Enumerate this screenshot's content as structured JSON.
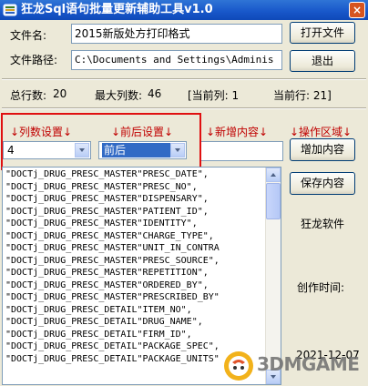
{
  "window": {
    "title": "狂龙Sql语句批量更新辅助工具v1.0",
    "close_glyph": "×"
  },
  "file_name": {
    "label": "文件名:",
    "value": "2015新版处方打印格式"
  },
  "file_path": {
    "label": "文件路径:",
    "value": "C:\\Documents and Settings\\Adminis"
  },
  "buttons": {
    "open_file": "打开文件",
    "exit": "退出",
    "add_content": "增加内容",
    "save_content": "保存内容"
  },
  "stats": {
    "total_label": "总行数:",
    "total_value": "20",
    "max_cols_label": "最大列数:",
    "max_cols_value": "46",
    "current_col": "[当前列: 1",
    "current_row": "当前行: 21]"
  },
  "section_headers": {
    "col_settings": "↓列数设置↓",
    "prefix_suffix": "↓前后设置↓",
    "new_content": "↓新增内容↓",
    "action_area": "↓操作区域↓"
  },
  "col_settings_combo": {
    "value": "4"
  },
  "prefix_suffix_combo": {
    "value": "前后"
  },
  "list_rows": [
    "\"DOCTj_DRUG_PRESC_MASTER\"PRESC_DATE\",",
    "\"DOCTj_DRUG_PRESC_MASTER\"PRESC_NO\",",
    "\"DOCTj_DRUG_PRESC_MASTER\"DISPENSARY\",",
    "\"DOCTj_DRUG_PRESC_MASTER\"PATIENT_ID\",",
    "\"DOCTj_DRUG_PRESC_MASTER\"IDENTITY\",",
    "\"DOCTj_DRUG_PRESC_MASTER\"CHARGE_TYPE\",",
    "\"DOCTj_DRUG_PRESC_MASTER\"UNIT_IN_CONTRA",
    "\"DOCTj_DRUG_PRESC_MASTER\"PRESC_SOURCE\",",
    "\"DOCTj_DRUG_PRESC_MASTER\"REPETITION\",",
    "\"DOCTj_DRUG_PRESC_MASTER\"ORDERED_BY\",",
    "\"DOCTj_DRUG_PRESC_MASTER\"PRESCRIBED_BY\"",
    "\"DOCTj_DRUG_PRESC_DETAIL\"ITEM_NO\",",
    "\"DOCTj_DRUG_PRESC_DETAIL\"DRUG_NAME\",",
    "\"DOCTj_DRUG_PRESC_DETAIL\"FIRM_ID\",",
    "\"DOCTj_DRUG_PRESC_DETAIL\"PACKAGE_SPEC\",",
    "\"DOCTj_DRUG_PRESC_DETAIL\"PACKAGE_UNITS\""
  ],
  "side_labels": {
    "software": "狂龙软件",
    "created_time_label": "创作时间:",
    "created_date": "2021-12-07"
  },
  "watermark": {
    "text": "3DMGAME"
  },
  "colors": {
    "title_bar": "#1756c9",
    "highlight_box": "#e01010",
    "header_text": "#c00000",
    "selection": "#316ac5"
  }
}
